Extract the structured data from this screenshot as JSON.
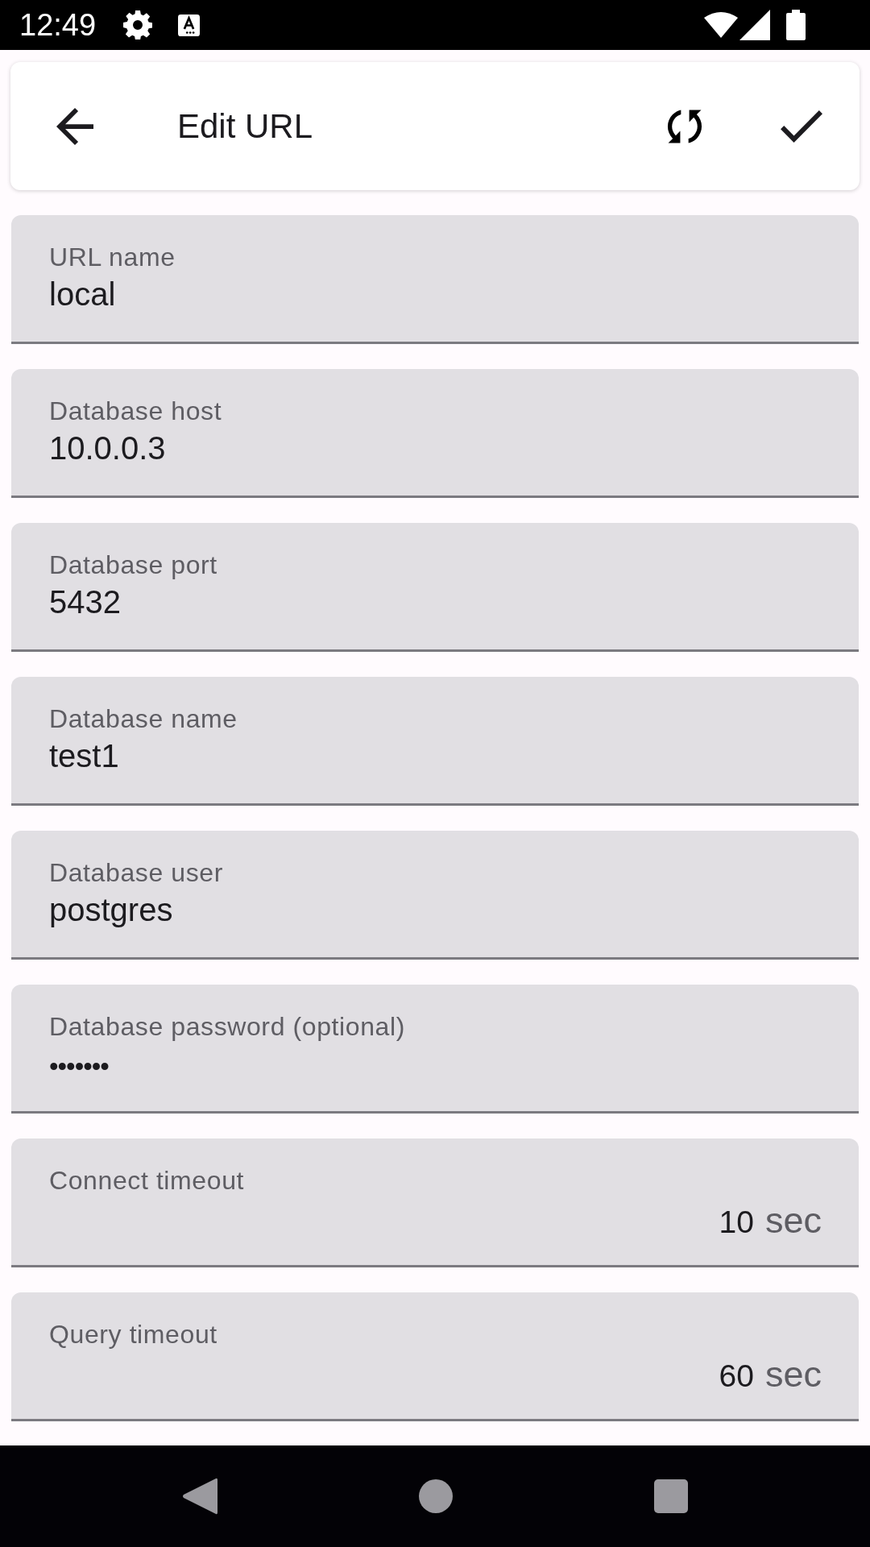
{
  "status_bar": {
    "time": "12:49"
  },
  "app_bar": {
    "title": "Edit URL"
  },
  "fields": [
    {
      "kind": "text",
      "label": "URL name",
      "value": "local"
    },
    {
      "kind": "text",
      "label": "Database host",
      "value": "10.0.0.3"
    },
    {
      "kind": "text",
      "label": "Database port",
      "value": "5432"
    },
    {
      "kind": "text",
      "label": "Database name",
      "value": "test1"
    },
    {
      "kind": "text",
      "label": "Database user",
      "value": "postgres"
    },
    {
      "kind": "password",
      "label": "Database password (optional)",
      "value": "•••••••"
    },
    {
      "kind": "number",
      "label": "Connect timeout",
      "value": "10",
      "suffix": "sec"
    },
    {
      "kind": "number",
      "label": "Query timeout",
      "value": "60",
      "suffix": "sec"
    }
  ]
}
